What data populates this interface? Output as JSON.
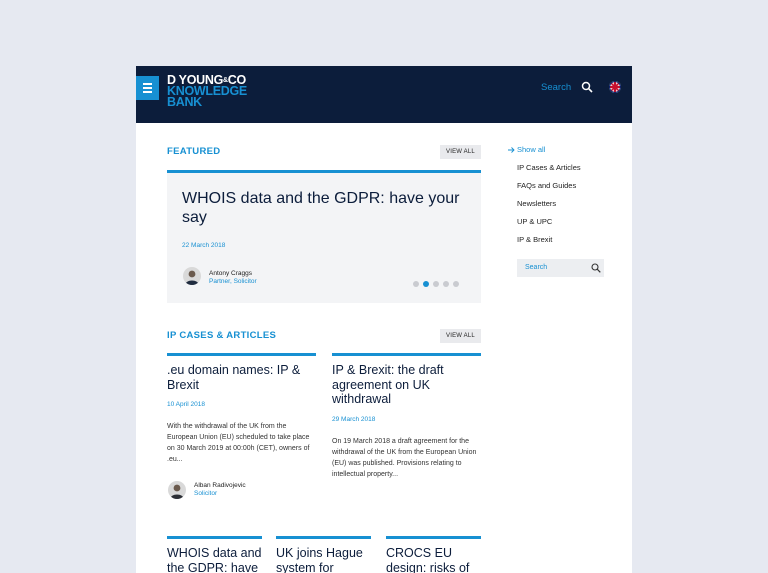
{
  "header": {
    "logo_line1": "D YOUNG",
    "logo_amp": "&",
    "logo_co": "CO",
    "logo_line2": "KNOWLEDGE",
    "logo_line3": "BANK",
    "search_label": "Search"
  },
  "featured": {
    "section_title": "FEATURED",
    "view_all": "VIEW ALL",
    "title": "WHOIS data and the GDPR: have your say",
    "date": "22 March 2018",
    "author_name": "Antony Craggs",
    "author_role": "Partner, Solicitor",
    "slide_count": 5,
    "active_slide": 2
  },
  "ip_cases": {
    "section_title": "IP CASES & ARTICLES",
    "view_all": "VIEW ALL",
    "articles": [
      {
        "title": ".eu domain names: IP & Brexit",
        "date": "10 April 2018",
        "text": "With the withdrawal of the UK from the European Union (EU) scheduled to take place on 30 March 2019 at 00:00h (CET), owners of .eu...",
        "author_name": "Alban Radivojevic",
        "author_role": "Solicitor"
      },
      {
        "title": "IP & Brexit: the draft agreement on UK withdrawal",
        "date": "29 March 2018",
        "text": "On 19 March 2018 a draft agreement for the withdrawal of the UK from the European Union (EU) was published. Provisions relating to intellectual property..."
      }
    ],
    "bottom_articles": [
      {
        "title": "WHOIS data and the GDPR: have"
      },
      {
        "title": "UK joins Hague system for"
      },
      {
        "title": "CROCS EU design: risks of"
      }
    ]
  },
  "sidebar": {
    "items": [
      {
        "label": "Show all"
      },
      {
        "label": "IP Cases & Articles"
      },
      {
        "label": "FAQs and Guides"
      },
      {
        "label": "Newsletters"
      },
      {
        "label": "UP & UPC"
      },
      {
        "label": "IP & Brexit"
      }
    ],
    "search_placeholder": "Search"
  },
  "colors": {
    "navy": "#0c1d3b",
    "accent": "#1790d2",
    "background": "#e6e9f1"
  }
}
